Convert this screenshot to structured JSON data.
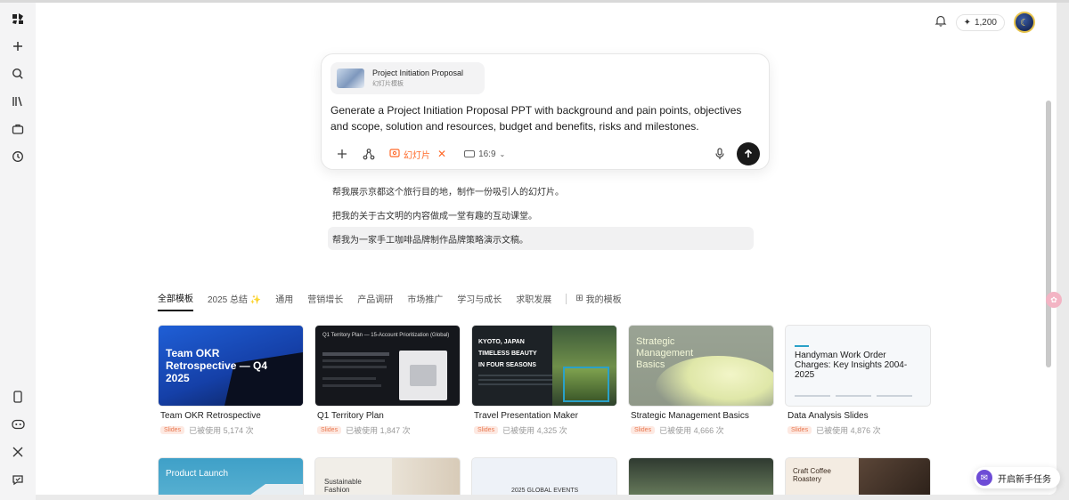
{
  "header": {
    "credits": "1,200"
  },
  "composer": {
    "template_chip": {
      "title": "Project Initiation Proposal",
      "subtitle": "幻灯片模板"
    },
    "prompt": "Generate a Project Initiation Proposal PPT with background and pain points, objectives and scope, solution and resources, budget and benefits, risks and milestones.",
    "mode_label": "幻灯片",
    "aspect_ratio": "16:9"
  },
  "suggestions": [
    "帮我展示京都这个旅行目的地，制作一份吸引人的幻灯片。",
    "把我的关于古文明的内容做成一堂有趣的互动课堂。",
    "帮我为一家手工咖啡品牌制作品牌策略演示文稿。"
  ],
  "tabs": [
    "全部模板",
    "2025 总结",
    "通用",
    "营销增长",
    "产品调研",
    "市场推广",
    "学习与成长",
    "求职发展"
  ],
  "my_templates": "我的模板",
  "cards": [
    {
      "title": "Team OKR Retrospective",
      "tag": "Slides",
      "uses": "已被使用 5,174 次",
      "thumb_text": "Team OKR Retrospective — Q4 2025"
    },
    {
      "title": "Q1 Territory Plan",
      "tag": "Slides",
      "uses": "已被使用 1,847 次",
      "thumb_text": "Q1 Territory Plan — 15-Account Prioritization (Global)"
    },
    {
      "title": "Travel Presentation Maker",
      "tag": "Slides",
      "uses": "已被使用 4,325 次",
      "thumb_text": "KYOTO, JAPAN TIMELESS BEAUTY IN FOUR SEASONS"
    },
    {
      "title": "Strategic Management Basics",
      "tag": "Slides",
      "uses": "已被使用 4,666 次",
      "thumb_text": "Strategic Management Basics"
    },
    {
      "title": "Data Analysis Slides",
      "tag": "Slides",
      "uses": "已被使用 4,876 次",
      "thumb_text": "Handyman Work Order Charges: Key Insights 2004-2025"
    }
  ],
  "bottom_cards": [
    {
      "thumb_text": "Product Launch"
    },
    {
      "thumb_text": "Sustainable Fashion"
    },
    {
      "thumb_text": "2025 GLOBAL EVENTS"
    },
    {
      "thumb_text": ""
    },
    {
      "thumb_text": "Craft Coffee Roastery"
    }
  ],
  "float_button": "开启新手任务",
  "colors": {
    "accent_orange": "#ff6a2a",
    "send_button": "#1a1a1a",
    "purple": "#6d4cd6"
  }
}
